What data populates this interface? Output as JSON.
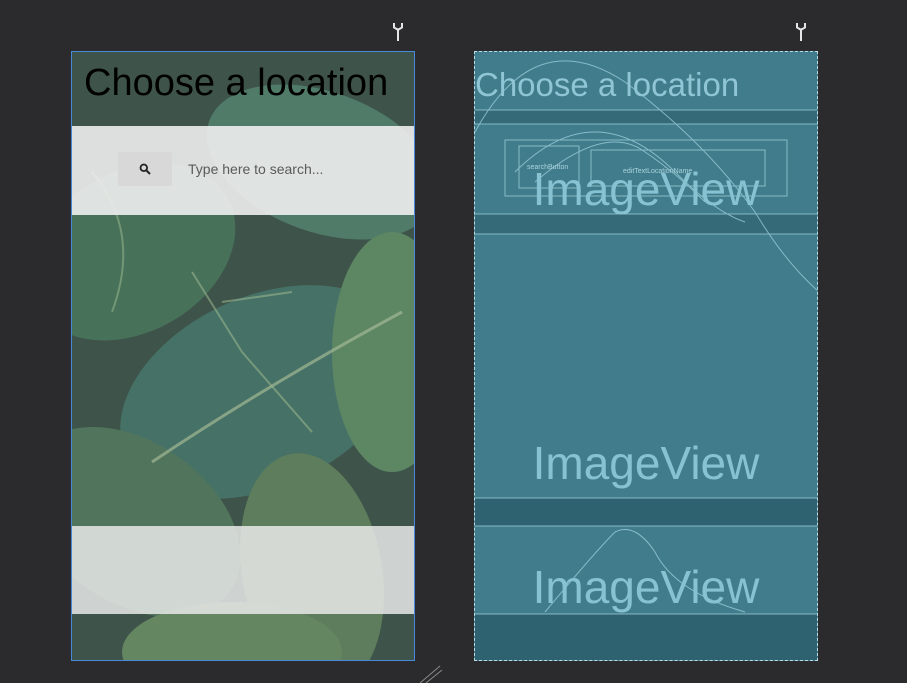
{
  "design": {
    "title": "Choose a location",
    "search_placeholder": "Type here to search...",
    "search_button_icon": "magnifier-icon"
  },
  "blueprint": {
    "title": "Choose a location",
    "image_views": [
      "ImageView",
      "ImageView",
      "ImageView"
    ],
    "search_button_label": "searchButton",
    "edit_text_label": "editTextLocationName"
  },
  "colors": {
    "canvas_bg": "#2b2b2d",
    "selection_border": "#4a88d8",
    "blueprint_bg": "#417c8c",
    "blueprint_line": "#9fd0dc",
    "blueprint_text": "#87c2d2"
  }
}
